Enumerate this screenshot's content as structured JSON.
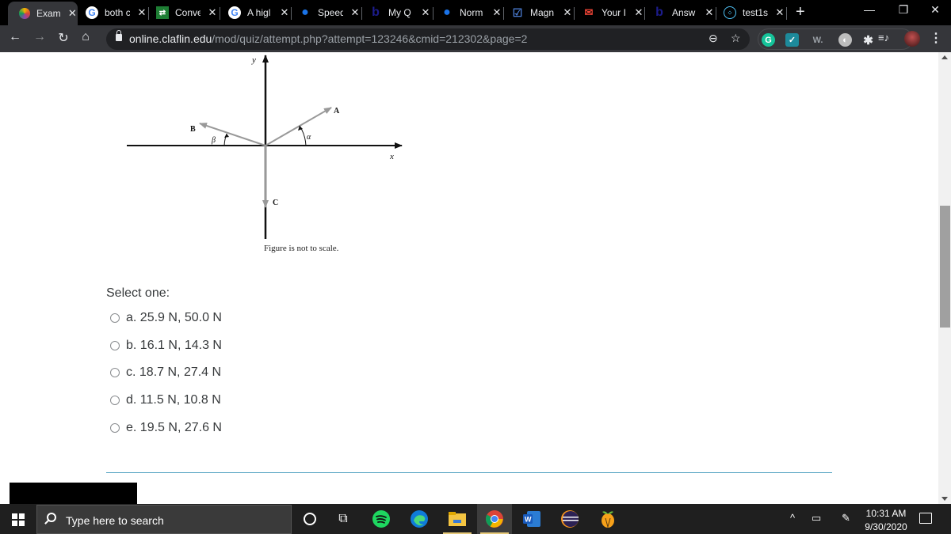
{
  "browser": {
    "tabs": [
      {
        "title": "Exam",
        "icon": "claflin-logo-icon",
        "active": true
      },
      {
        "title": "both c",
        "icon": "google-icon"
      },
      {
        "title": "Conve",
        "icon": "converter-icon"
      },
      {
        "title": "A higl",
        "icon": "google-icon"
      },
      {
        "title": "Speed",
        "icon": "dot-logo-icon"
      },
      {
        "title": "My Q",
        "icon": "bartleby-icon"
      },
      {
        "title": "Norm",
        "icon": "dot-logo-icon"
      },
      {
        "title": "Magn",
        "icon": "checkbox-icon"
      },
      {
        "title": "Your I",
        "icon": "gmail-icon"
      },
      {
        "title": "Answ",
        "icon": "bartleby-icon"
      },
      {
        "title": "test1s",
        "icon": "circle-dots-icon"
      }
    ],
    "close_glyph": "✕",
    "new_tab_glyph": "+",
    "window_controls": {
      "minimize": "—",
      "restore": "❐",
      "close": "✕"
    },
    "url_host": "online.claflin.edu",
    "url_path": "/mod/quiz/attempt.php?attempt=123246&cmid=212302&page=2",
    "nav": {
      "back": "←",
      "forward": "→",
      "reload": "↻",
      "home": "⌂"
    },
    "omnibox_icons": {
      "zoom": "⊖",
      "bookmark": "☆"
    },
    "extensions": [
      {
        "name": "grammarly",
        "glyph": "G",
        "bg": "#15c39a",
        "fg": "#fff"
      },
      {
        "name": "ext-teal",
        "glyph": "✓",
        "bg": "#1d8a9b",
        "fg": "#fff"
      },
      {
        "name": "w-ext",
        "glyph": "W.",
        "bg": "transparent",
        "fg": "#9aa0a6"
      },
      {
        "name": "ext-grey",
        "glyph": "◐",
        "bg": "#bdbdbd",
        "fg": "#fff"
      },
      {
        "name": "puzzle",
        "glyph": "✱",
        "bg": "transparent",
        "fg": "#e8eaed"
      }
    ],
    "media_glyph": "≡♪",
    "menu_glyph": "⋮"
  },
  "figure": {
    "axis_x_label": "x",
    "axis_y_label": "y",
    "vector_a_label": "A",
    "vector_b_label": "B",
    "vector_c_label": "C",
    "angle_alpha": "α",
    "angle_beta": "β",
    "caption": "Figure is not to scale."
  },
  "question": {
    "prompt": "Select one:",
    "options": [
      {
        "letter": "a.",
        "text": "25.9 N, 50.0 N"
      },
      {
        "letter": "b.",
        "text": "16.1 N, 14.3 N"
      },
      {
        "letter": "c.",
        "text": "18.7 N, 27.4 N"
      },
      {
        "letter": "d.",
        "text": "11.5 N, 10.8 N"
      },
      {
        "letter": "e.",
        "text": "19.5 N, 27.6 N"
      }
    ]
  },
  "taskbar": {
    "search_placeholder": "Type here to search",
    "apps": [
      "cortana",
      "task-view",
      "spotify",
      "edge",
      "file-explorer",
      "chrome",
      "word",
      "eclipse",
      "fl-studio"
    ],
    "tray": {
      "chevron": "^",
      "battery": "▭",
      "pen": "✎"
    },
    "time": "10:31 AM",
    "date": "9/30/2020"
  }
}
